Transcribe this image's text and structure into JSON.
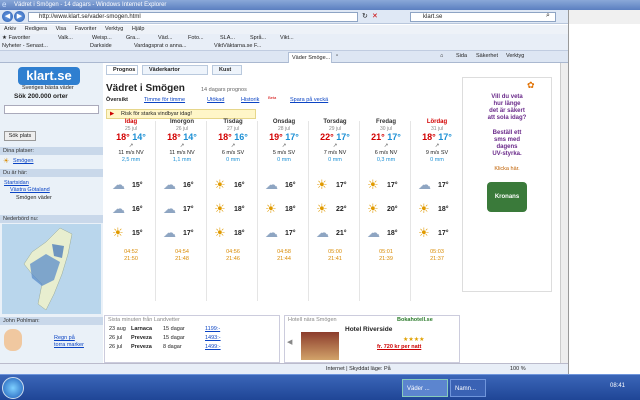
{
  "window": {
    "title": "Vädret i Smögen - 14 dagars - Windows Internet Explorer"
  },
  "address": {
    "url": "http://www.klart.se/vader-smogen.html",
    "search": "klart.se"
  },
  "menu": [
    "Arkiv",
    "Redigera",
    "Visa",
    "Favoriter",
    "Verktyg",
    "Hjälp"
  ],
  "favorites": {
    "label": "Favoriter",
    "items": [
      "Valk...",
      "Weisp...",
      "Gra...",
      "Väd...",
      "Foto...",
      "SLA...",
      "Språ...",
      "Vikt..."
    ],
    "row2": [
      "Nyheter - Senast...",
      "Darkside",
      "Vardagsprat o anna...",
      "ViktVäktarna.se F...",
      "Väder Smöge..."
    ]
  },
  "ie_toolbar": [
    "Sida",
    "Säkerhet",
    "Verktyg"
  ],
  "site": {
    "logo": "klart.se",
    "tagline": "Sveriges bästa väder",
    "search_label": "Sök 200.000 orter",
    "search_button": "Sök plats",
    "tabs": [
      "Prognos",
      "Väderkartor",
      "Kust"
    ],
    "heading": "Vädret i Smögen",
    "heading_sub": "14 dagars prognos",
    "subtabs": [
      "Översikt",
      "Timme för timme",
      "Utökad",
      "Historik",
      "Spara på veckä"
    ],
    "beta": "Beta",
    "warning": "Risk för starka vindbyar idag!",
    "left": {
      "places_title": "Dina platser:",
      "place": "Smögen",
      "here_title": "Du är här:",
      "crumbs": [
        "Startsidan",
        "Västra Götaland",
        "Smögen väder"
      ],
      "radar_title": "Nederbörd nu:",
      "blog_title": "John Pohlman:",
      "blog_link": "Regn på torra marker"
    },
    "days": [
      {
        "name": "Idag",
        "date": "25 jul",
        "max": "18°",
        "min": "14°",
        "wind": "11 m/s NV",
        "rain": "2,5 mm",
        "t1": "15°",
        "t2": "16°",
        "t3": "15°",
        "sunrise": "04:52",
        "sunset": "21:50",
        "maxlbl": "Max",
        "minlbl": "Min"
      },
      {
        "name": "Imorgon",
        "date": "26 jul",
        "max": "18°",
        "min": "14°",
        "wind": "11 m/s NV",
        "rain": "1,1 mm",
        "t1": "16°",
        "t2": "17°",
        "t3": "17°",
        "sunrise": "04:54",
        "sunset": "21:48"
      },
      {
        "name": "Tisdag",
        "date": "27 jul",
        "max": "18°",
        "min": "16°",
        "wind": "6 m/s SV",
        "rain": "0 mm",
        "t1": "16°",
        "t2": "18°",
        "t3": "18°",
        "sunrise": "04:56",
        "sunset": "21:46"
      },
      {
        "name": "Onsdag",
        "date": "28 jul",
        "max": "19°",
        "min": "17°",
        "wind": "5 m/s SV",
        "rain": "0 mm",
        "t1": "16°",
        "t2": "18°",
        "t3": "17°",
        "sunrise": "04:58",
        "sunset": "21:44"
      },
      {
        "name": "Torsdag",
        "date": "29 jul",
        "max": "22°",
        "min": "17°",
        "wind": "7 m/s NV",
        "rain": "0 mm",
        "t1": "17°",
        "t2": "22°",
        "t3": "21°",
        "sunrise": "05:00",
        "sunset": "21:41"
      },
      {
        "name": "Fredag",
        "date": "30 jul",
        "max": "21°",
        "min": "17°",
        "wind": "6 m/s NV",
        "rain": "0,3 mm",
        "t1": "17°",
        "t2": "20°",
        "t3": "18°",
        "sunrise": "05:01",
        "sunset": "21:39"
      },
      {
        "name": "Lördag",
        "date": "31 jul",
        "max": "18°",
        "min": "17°",
        "wind": "9 m/s SV",
        "rain": "0 mm",
        "t1": "17°",
        "t2": "18°",
        "t3": "17°",
        "sunrise": "05:03",
        "sunset": "21:37"
      }
    ],
    "last_minute": {
      "title": "Sista minuten från Landvetter",
      "rows": [
        {
          "date": "23 aug",
          "dest": "Larnaca",
          "days": "15 dagar",
          "price": "1199:-"
        },
        {
          "date": "26 jul",
          "dest": "Preveza",
          "days": "15 dagar",
          "price": "1493:-"
        },
        {
          "date": "26 jul",
          "dest": "Preveza",
          "days": "8 dagar",
          "price": "1499:-"
        }
      ]
    },
    "hotel": {
      "title": "Hotell nära Smögen",
      "brand": "Bokahotell.se",
      "name": "Hotel Riverside",
      "price": "fr. 720 kr per natt"
    },
    "ad": {
      "l1": "Vill du veta",
      "l2": "hur länge",
      "l3": "det är säkert",
      "l4": "att sola idag?",
      "l5": "Beställ ett",
      "l6": "sms med",
      "l7": "dagens",
      "l8": "UV-styrka.",
      "l9": "Klicka här.",
      "brand": "Kronans"
    }
  },
  "status": {
    "zone": "Internet | Skyddat läge: På",
    "zoom": "100 %"
  },
  "taskbar": {
    "item1": "Väder ...",
    "item2": "Namn...",
    "time": "08:41"
  },
  "colors": {
    "accent": "#0b44c4",
    "max": "#d20000",
    "min": "#1b8fd4"
  }
}
